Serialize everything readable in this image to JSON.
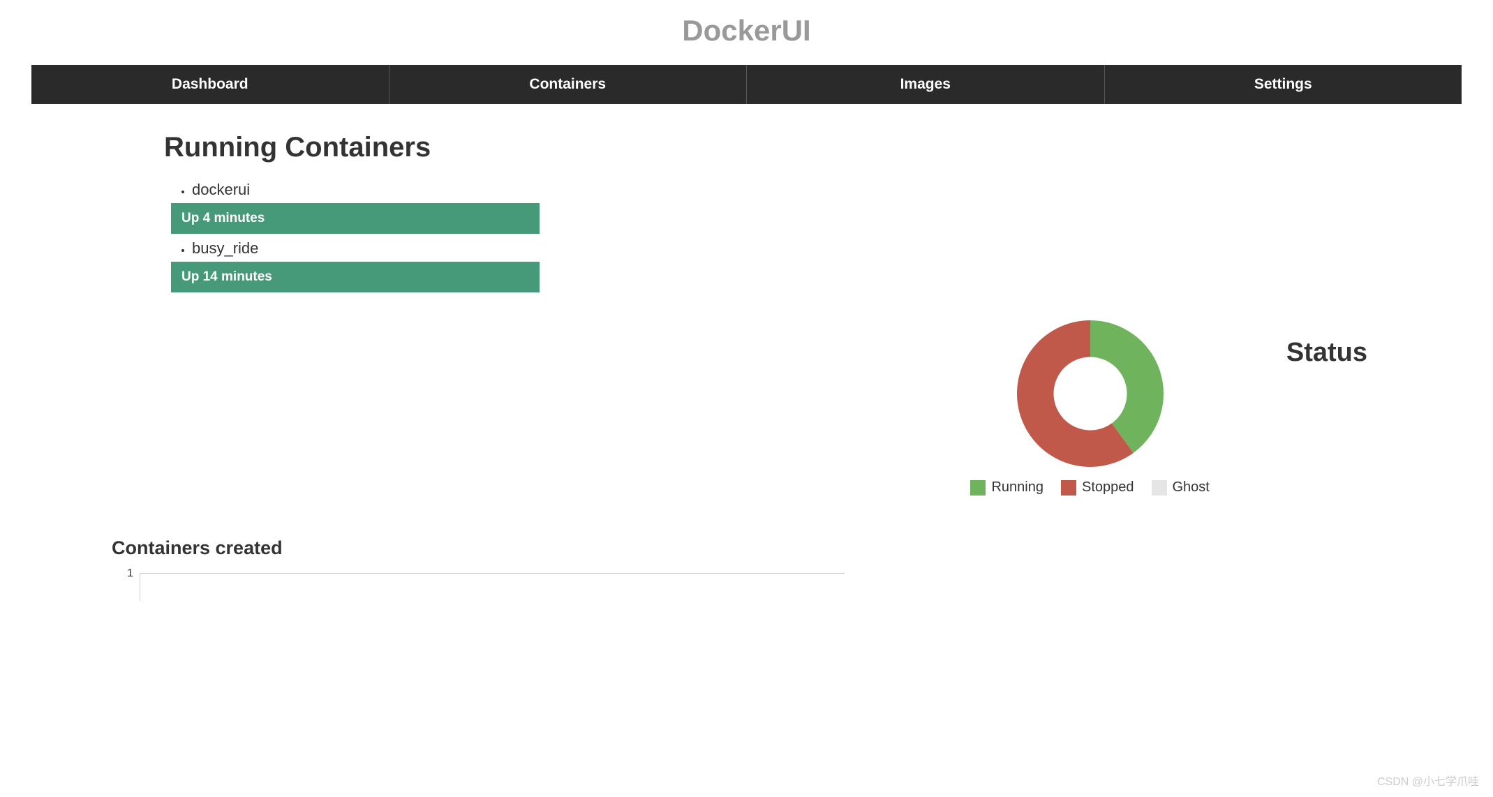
{
  "header": {
    "title": "DockerUI"
  },
  "nav": {
    "items": [
      "Dashboard",
      "Containers",
      "Images",
      "Settings"
    ]
  },
  "running": {
    "title": "Running Containers",
    "containers": [
      {
        "name": "dockerui",
        "status": "Up 4 minutes"
      },
      {
        "name": "busy_ride",
        "status": "Up 14 minutes"
      }
    ]
  },
  "status": {
    "title": "Status",
    "legend": [
      {
        "label": "Running",
        "color": "#6fb35d"
      },
      {
        "label": "Stopped",
        "color": "#c1594b"
      },
      {
        "label": "Ghost",
        "color": "#e5e5e5"
      }
    ]
  },
  "chart_data": {
    "type": "pie",
    "title": "Status",
    "series": [
      {
        "name": "Running",
        "value": 2,
        "color": "#6fb35d"
      },
      {
        "name": "Stopped",
        "value": 3,
        "color": "#c1594b"
      },
      {
        "name": "Ghost",
        "value": 0,
        "color": "#e5e5e5"
      }
    ]
  },
  "created": {
    "title": "Containers created",
    "y_tick": "1"
  },
  "watermark": "CSDN @小七学爪哇"
}
